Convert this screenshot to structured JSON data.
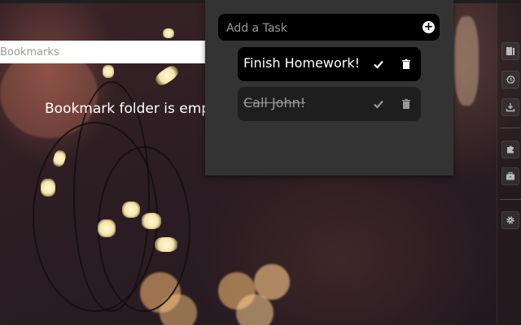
{
  "bookmarks": {
    "search_placeholder": "Bookmarks",
    "empty_message": "Bookmark folder is empty"
  },
  "todo": {
    "input_placeholder": "Add a Task",
    "add_icon": "plus-circle-icon",
    "tasks": [
      {
        "label": "Finish Homework!",
        "completed": false
      },
      {
        "label": "Call John!",
        "completed": true
      }
    ]
  },
  "sidebar": {
    "icons": [
      "bookmarks-icon",
      "history-icon",
      "download-icon",
      "puzzle-icon",
      "briefcase-icon",
      "settings-icon"
    ]
  },
  "colors": {
    "panel_bg": "#333333",
    "task_bg": "#000000",
    "done_task_bg": "#1e1e1e",
    "done_text": "#9a9a9a"
  }
}
